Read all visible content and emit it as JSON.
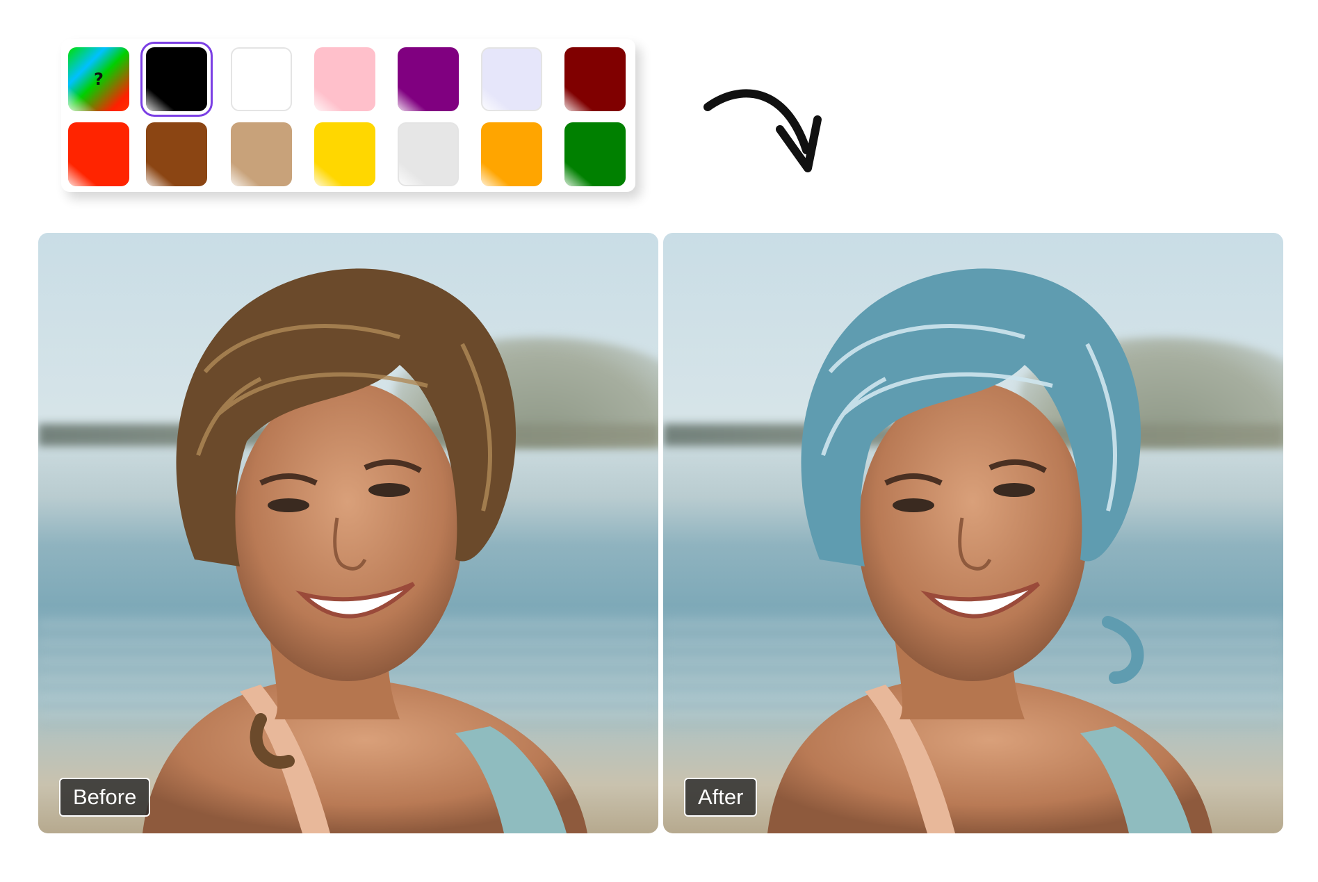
{
  "palette": {
    "swatches": [
      {
        "id": "custom",
        "color": "multi",
        "symbol": "?",
        "selected": false
      },
      {
        "id": "black",
        "color": "#000000",
        "selected": true
      },
      {
        "id": "white",
        "color": "#ffffff",
        "selected": false
      },
      {
        "id": "pink",
        "color": "#ffc0cb",
        "selected": false
      },
      {
        "id": "purple",
        "color": "#800080",
        "selected": false
      },
      {
        "id": "lavender",
        "color": "#e6e6fa",
        "selected": false
      },
      {
        "id": "maroon",
        "color": "#800000",
        "selected": false
      },
      {
        "id": "red",
        "color": "#ff2400",
        "selected": false
      },
      {
        "id": "brown",
        "color": "#8b4513",
        "selected": false
      },
      {
        "id": "tan",
        "color": "#c8a27a",
        "selected": false
      },
      {
        "id": "yellow",
        "color": "#ffd700",
        "selected": false
      },
      {
        "id": "light-gray",
        "color": "#e6e6e6",
        "selected": false
      },
      {
        "id": "orange",
        "color": "#ffa500",
        "selected": false
      },
      {
        "id": "green",
        "color": "#008000",
        "selected": false
      }
    ]
  },
  "arrow": {
    "icon": "curved-arrow-down-right-icon",
    "color": "#111111"
  },
  "before": {
    "label": "Before",
    "hair_color": "#6b4a2b",
    "hair_highlight": "#b08a58"
  },
  "after": {
    "label": "After",
    "hair_color": "#5f9cb0",
    "hair_highlight": "#cfe6ee"
  }
}
